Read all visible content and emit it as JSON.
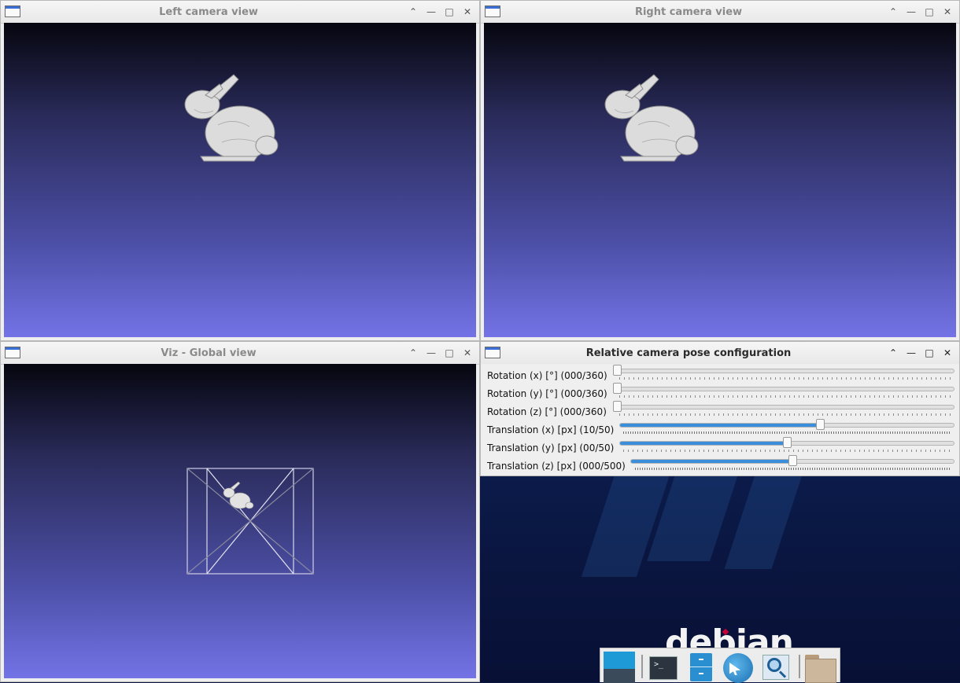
{
  "windows": {
    "left": {
      "title": "Left camera view"
    },
    "right": {
      "title": "Right camera view"
    },
    "global": {
      "title": "Viz - Global view"
    },
    "config": {
      "title": "Relative camera pose configuration",
      "sliders": [
        {
          "label": "Rotation (x) [°] (000/360)",
          "fraction": 0.0
        },
        {
          "label": "Rotation (y) [°] (000/360)",
          "fraction": 0.0
        },
        {
          "label": "Rotation (z) [°] (000/360)",
          "fraction": 0.0
        },
        {
          "label": "Translation (x) [px] (10/50)",
          "fraction": 0.6
        },
        {
          "label": "Translation (y) [px] (00/50)",
          "fraction": 0.5
        },
        {
          "label": "Translation (z) [px] (000/500)",
          "fraction": 0.5
        }
      ]
    }
  },
  "window_controls": {
    "shade": "⌃",
    "minimize": "—",
    "maximize": "□",
    "close": "✕"
  },
  "desktop": {
    "logo_text": "debian"
  },
  "dock": {
    "items": [
      "workspace-switcher-icon",
      "terminal-icon",
      "file-manager-icon",
      "web-browser-icon",
      "search-icon",
      "folder-icon"
    ]
  },
  "colors": {
    "viewport_top": "#06060f",
    "viewport_bottom": "#7373e6",
    "slider_fill": "#3b8ed9",
    "debian_red": "#c70036"
  }
}
